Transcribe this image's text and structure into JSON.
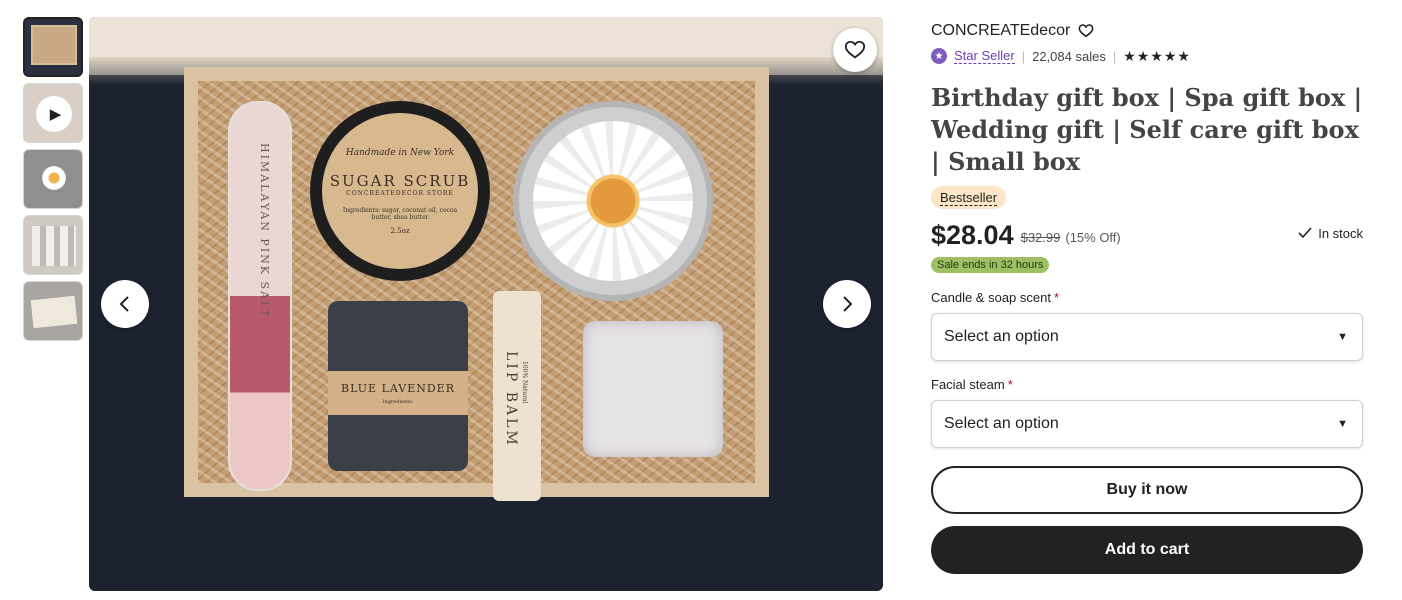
{
  "gallery": {
    "thumbnails": [
      {
        "kind": "image",
        "active": true
      },
      {
        "kind": "video",
        "icon": "play-icon"
      },
      {
        "kind": "image"
      },
      {
        "kind": "image"
      },
      {
        "kind": "image"
      }
    ],
    "prev_icon": "chevron-left-icon",
    "next_icon": "chevron-right-icon",
    "favorite_icon": "heart-icon",
    "product_labels": {
      "scrub_top": "Handmade in New York",
      "scrub_name": "SUGAR SCRUB",
      "scrub_store": "CONCREATEDECOR STORE",
      "scrub_ingredients": "Ingredients: sugar, coconut oil, cocoa butter, shea butter",
      "scrub_weight": "2.5oz",
      "salt_tube": "HIMALAYAN PINK SALT",
      "lavender_name": "BLUE LAVENDER",
      "lavender_sub": "Ingredients:",
      "lip_balm": "LIP BALM",
      "lip_balm_sub": "100% Natural"
    }
  },
  "shop": {
    "name": "CONCREATEdecor",
    "follow_icon": "heart-icon",
    "star_seller_label": "Star Seller",
    "star_seller_icon": "star-badge-icon",
    "sales": "22,084 sales",
    "rating_stars": 5,
    "rating_text": "★★★★★"
  },
  "product": {
    "title": "Birthday gift box | Spa gift box | Wedding gift | Self care gift box | Small box",
    "badge": "Bestseller",
    "price": "$28.04",
    "original_price": "$32.99",
    "discount": "(15% Off)",
    "stock": "In stock",
    "sale_notice": "Sale ends in 32 hours"
  },
  "options": [
    {
      "label": "Candle & soap scent",
      "required_mark": "*",
      "placeholder": "Select an option"
    },
    {
      "label": "Facial steam",
      "required_mark": "*",
      "placeholder": "Select an option"
    }
  ],
  "actions": {
    "buy_now": "Buy it now",
    "add_to_cart": "Add to cart"
  },
  "colors": {
    "star_seller": "#6a3fb5",
    "bestseller_bg": "#fde6c8",
    "sale_pill": "#9ec063",
    "required": "#a0102a",
    "cart_bg": "#222222"
  }
}
